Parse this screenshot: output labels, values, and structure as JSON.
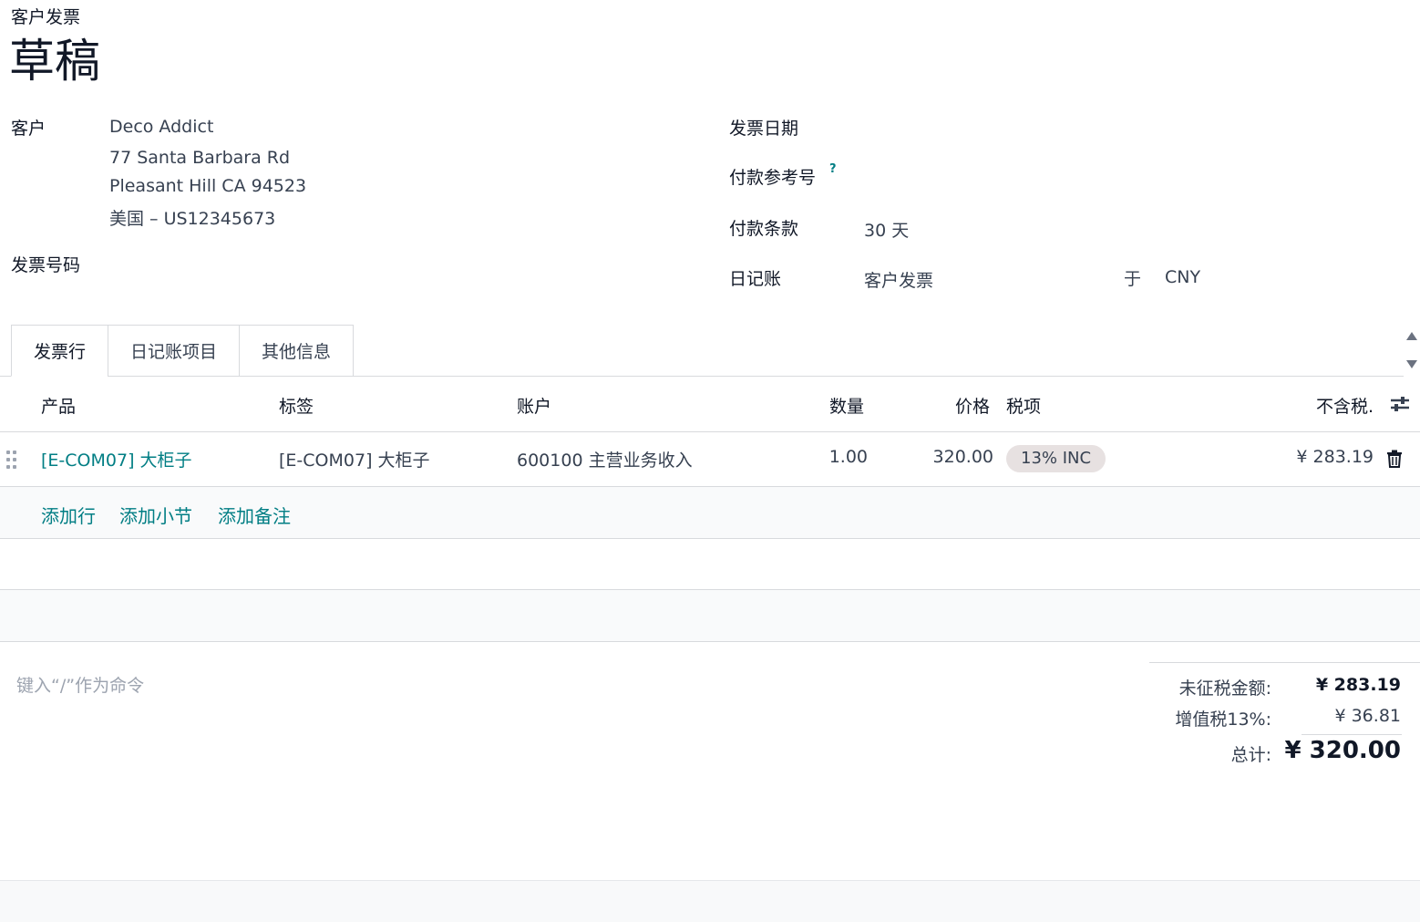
{
  "header": {
    "doc_type": "客户发票",
    "state": "草稿"
  },
  "customer": {
    "label": "客户",
    "name": "Deco Addict",
    "street": "77 Santa Barbara Rd",
    "city_line": "Pleasant Hill CA 94523",
    "country_line": "美国 – US12345673"
  },
  "invoice_number": {
    "label": "发票号码"
  },
  "invoice_date": {
    "label": "发票日期"
  },
  "payment_reference": {
    "label": "付款参考号",
    "help": "?"
  },
  "payment_terms": {
    "label": "付款条款",
    "value": "30 天"
  },
  "journal": {
    "label": "日记账",
    "value": "客户发票",
    "in_label": "于",
    "currency": "CNY"
  },
  "tabs": [
    {
      "label": "发票行",
      "active": true
    },
    {
      "label": "日记账项目",
      "active": false
    },
    {
      "label": "其他信息",
      "active": false
    }
  ],
  "table": {
    "columns": {
      "product": "产品",
      "label": "标签",
      "account": "账户",
      "quantity": "数量",
      "price": "价格",
      "taxes": "税项",
      "subtotal": "不含税."
    },
    "rows": [
      {
        "product": "[E-COM07] 大柜子",
        "label": "[E-COM07] 大柜子",
        "account": "600100 主营业务收入",
        "quantity": "1.00",
        "price": "320.00",
        "tax": "13% INC",
        "subtotal": "¥ 283.19"
      }
    ]
  },
  "add_actions": {
    "line": "添加行",
    "section": "添加小节",
    "note": "添加备注"
  },
  "notes": {
    "placeholder": "键入“/”作为命令"
  },
  "totals": {
    "untaxed_label": "未征税金额:",
    "untaxed_value": "¥ 283.19",
    "vat_label": "增值税13%:",
    "vat_value": "¥ 36.81",
    "total_label": "总计:",
    "total_value": "¥ 320.00"
  },
  "colors": {
    "accent": "#017e84",
    "badge_bg": "#e7e1e1",
    "border": "#d8dadd"
  },
  "icons": {
    "optional_columns": "sliders-icon",
    "delete": "trash-icon",
    "handle": "drag-handle-icon"
  }
}
